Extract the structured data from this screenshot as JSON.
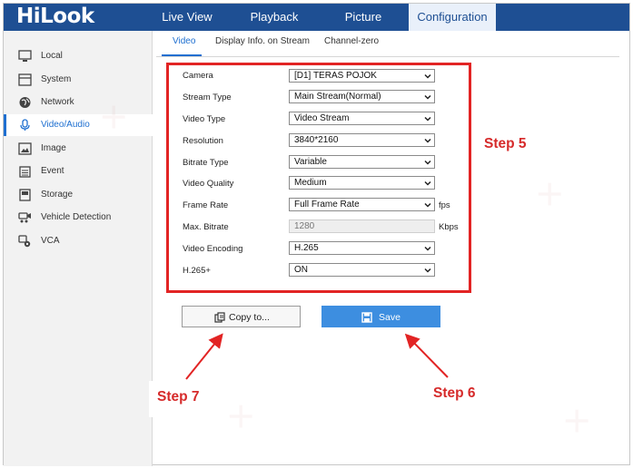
{
  "brand": {
    "logo_text": "HiLook"
  },
  "top_nav": {
    "items": [
      {
        "label": "Live View"
      },
      {
        "label": "Playback"
      },
      {
        "label": "Picture"
      },
      {
        "label": "Configuration",
        "active": true
      }
    ]
  },
  "sidebar": {
    "items": [
      {
        "label": "Local",
        "icon": "monitor-icon"
      },
      {
        "label": "System",
        "icon": "system-icon"
      },
      {
        "label": "Network",
        "icon": "globe-icon"
      },
      {
        "label": "Video/Audio",
        "icon": "microphone-icon",
        "active": true
      },
      {
        "label": "Image",
        "icon": "image-icon"
      },
      {
        "label": "Event",
        "icon": "calendar-icon"
      },
      {
        "label": "Storage",
        "icon": "storage-icon"
      },
      {
        "label": "Vehicle Detection",
        "icon": "vehicle-camera-icon"
      },
      {
        "label": "VCA",
        "icon": "vca-icon"
      }
    ]
  },
  "subtabs": [
    {
      "label": "Video",
      "active": true
    },
    {
      "label": "Display Info. on Stream"
    },
    {
      "label": "Channel-zero"
    }
  ],
  "form": {
    "camera": {
      "label": "Camera",
      "value": "[D1] TERAS POJOK"
    },
    "stream_type": {
      "label": "Stream Type",
      "value": "Main Stream(Normal)"
    },
    "video_type": {
      "label": "Video Type",
      "value": "Video Stream"
    },
    "resolution": {
      "label": "Resolution",
      "value": "3840*2160"
    },
    "bitrate_type": {
      "label": "Bitrate Type",
      "value": "Variable"
    },
    "video_quality": {
      "label": "Video Quality",
      "value": "Medium"
    },
    "frame_rate": {
      "label": "Frame Rate",
      "value": "Full Frame Rate",
      "unit": "fps"
    },
    "max_bitrate": {
      "label": "Max. Bitrate",
      "value": "1280",
      "unit": "Kbps"
    },
    "video_encoding": {
      "label": "Video Encoding",
      "value": "H.265"
    },
    "h265_plus": {
      "label": "H.265+",
      "value": "ON"
    }
  },
  "buttons": {
    "copy_to": "Copy to...",
    "save": "Save"
  },
  "annotations": {
    "step5": "Step 5",
    "step6": "Step 6",
    "step7": "Step 7"
  },
  "colors": {
    "topbar": "#1e4f93",
    "accent": "#1e6fd0",
    "save_button": "#3d8ee0",
    "annotation_red": "#e22424"
  }
}
